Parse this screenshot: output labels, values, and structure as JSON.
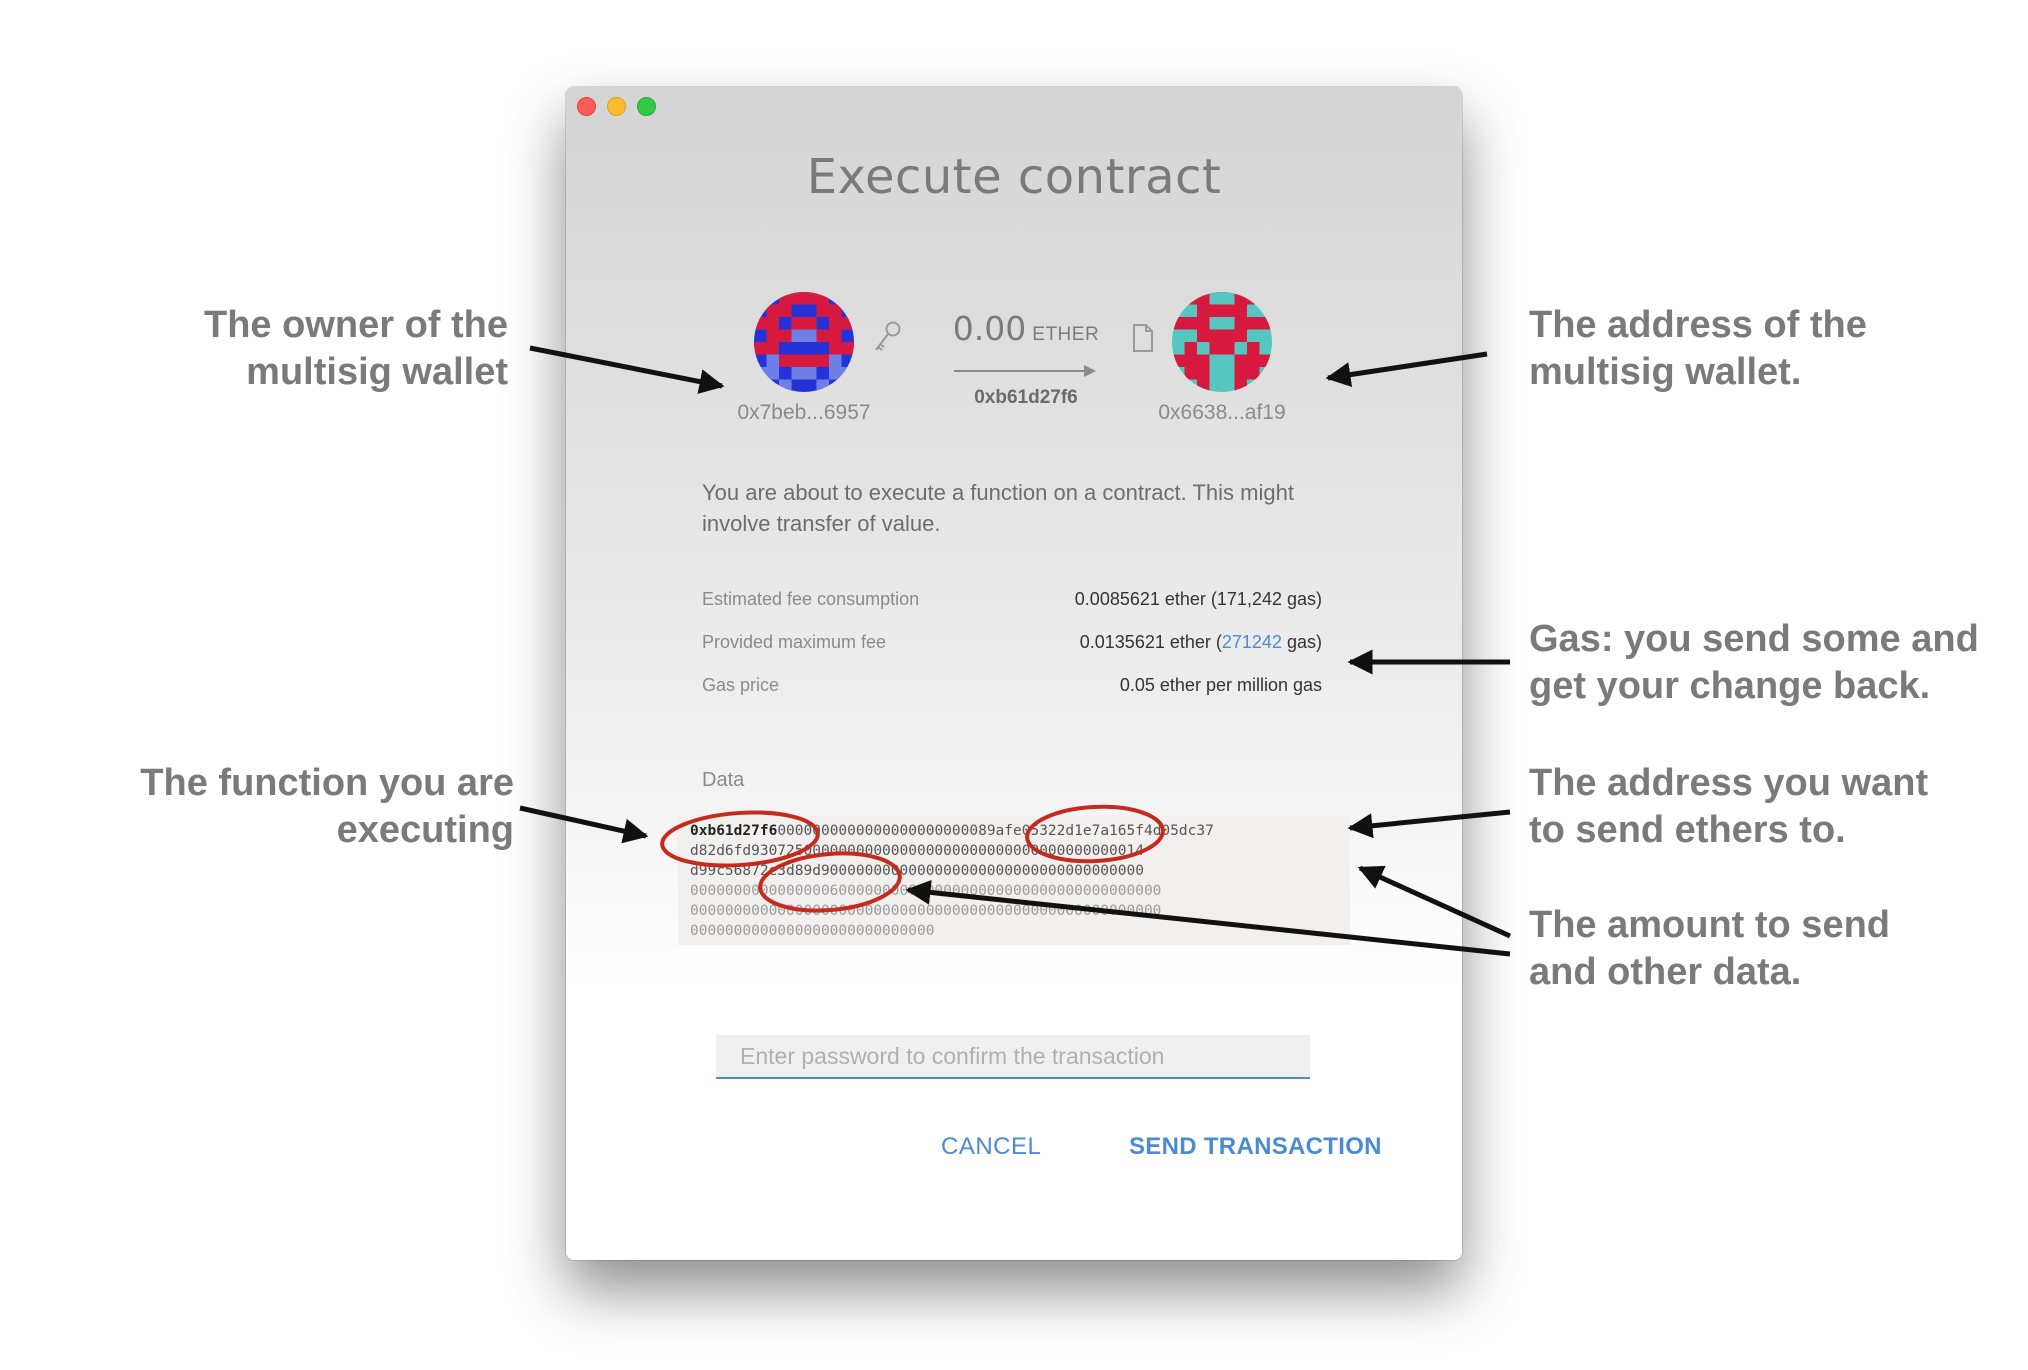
{
  "window": {
    "title": "Execute contract"
  },
  "transaction": {
    "from_address": "0x7beb...6957",
    "amount": "0.00",
    "unit": "ETHER",
    "contract_address": "0xb61d27f6",
    "to_address": "0x6638...af19"
  },
  "description": "You are about to execute a function on a contract. This might involve transfer of value.",
  "fees": {
    "estimated_label": "Estimated fee consumption",
    "estimated_value": "0.0085621 ether (171,242 gas)",
    "max_label": "Provided maximum fee",
    "max_value_prefix": "0.0135621 ether (",
    "max_value_link": "271242",
    "max_value_suffix": " gas)",
    "gas_price_label": "Gas price",
    "gas_price_value": "0.05 ether per million gas"
  },
  "data": {
    "label": "Data",
    "line1_fn": "0xb61d27f6",
    "line1_rest": "0000000000000000000000089afe05322d1e7a165f4d05dc37",
    "line2": "d82d6fd930725000000000000000000000000000000000000014",
    "line3": "d99c56872e3d89d9000000000000000000000000000000000000",
    "line4": "000000000000000060000000000000000000000000000000000000",
    "line5": "000000000000000000000000000000000000000000000000000000",
    "line6": "0000000000000000000000000000"
  },
  "password": {
    "placeholder": "Enter password to confirm the transaction"
  },
  "buttons": {
    "cancel": "CANCEL",
    "send": "SEND TRANSACTION"
  },
  "annotations": {
    "owner_line1": "The owner of the",
    "owner_line2": "multisig wallet",
    "multisig_line1": "The address of the",
    "multisig_line2": "multisig wallet.",
    "gas_line1": "Gas: you send some and",
    "gas_line2": "get your change back.",
    "function_line1": "The function you are",
    "function_line2": "executing",
    "address_line1": "The address you want",
    "address_line2": "to send ethers to.",
    "amount_line1": "The amount to send",
    "amount_line2": "and other data."
  },
  "colors": {
    "accent": "#4a8bd3",
    "annotation_text": "#7a7a7a",
    "circle_red": "#c62a1e"
  },
  "icons": {
    "key": "key-icon",
    "document": "document-icon",
    "arrow": "arrow-right-icon"
  }
}
